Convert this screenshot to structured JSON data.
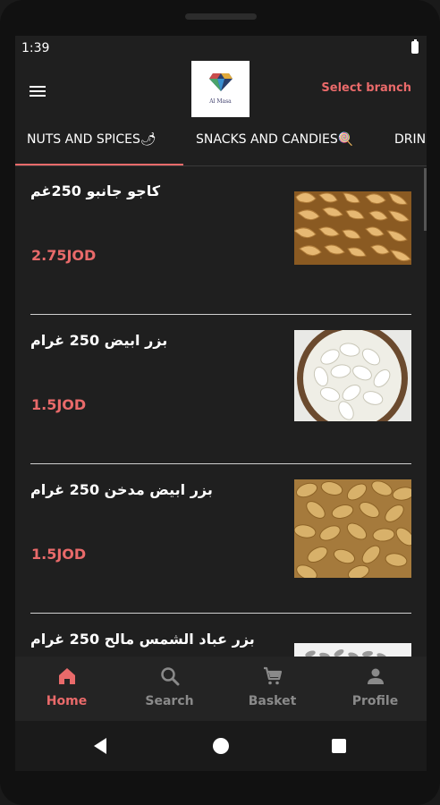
{
  "status_bar": {
    "time": "1:39"
  },
  "app_bar": {
    "logo_text": "Al Masa",
    "select_branch_label": "Select branch"
  },
  "tabs": [
    {
      "label": "NUTS AND SPICES🌶",
      "active": true
    },
    {
      "label": "SNACKS AND CANDIES🍭",
      "active": false
    },
    {
      "label": "DRIN",
      "active": false
    }
  ],
  "products": [
    {
      "name": "كاجو جانبو 250غم",
      "price": "2.75JOD",
      "image": "cashew-nuts"
    },
    {
      "name": "بزر ابيض 250 غرام",
      "price": "1.5JOD",
      "image": "white-seeds"
    },
    {
      "name": "بزر ابيض مدخن 250 غرام",
      "price": "1.5JOD",
      "image": "smoked-seeds"
    },
    {
      "name": "بزر عباد الشمس مالح 250 غرام",
      "price": "",
      "image": "sunflower-seeds"
    }
  ],
  "bottom_nav": [
    {
      "label": "Home",
      "icon": "home-icon",
      "active": true
    },
    {
      "label": "Search",
      "icon": "search-icon",
      "active": false
    },
    {
      "label": "Basket",
      "icon": "cart-icon",
      "active": false
    },
    {
      "label": "Profile",
      "icon": "profile-icon",
      "active": false
    }
  ],
  "colors": {
    "accent": "#e96a6a",
    "background": "#1f1f1f",
    "inactive_nav": "#8a8a8a"
  }
}
